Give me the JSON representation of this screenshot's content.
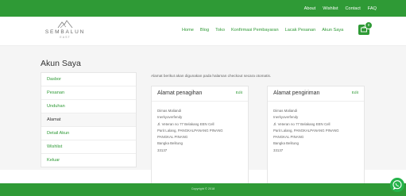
{
  "topbar": {
    "links": [
      "About",
      "Wishlist",
      "Contact",
      "FAQ"
    ]
  },
  "brand": {
    "name": "SEMBALUN",
    "tagline": "EAST"
  },
  "nav": {
    "items": [
      "Home",
      "Blog",
      "Toko",
      "Konfirmasi Pembayaran",
      "Lacak Pesanan",
      "Akun Saya"
    ]
  },
  "cart": {
    "count": "0"
  },
  "page": {
    "title": "Akun Saya",
    "note": "Alamat berikut akan digunakan pada halaman checkout secara otomatis."
  },
  "sidebar": {
    "items": [
      "Dasbor",
      "Pesanan",
      "Unduhan",
      "Alamat",
      "Detail Akun",
      "Wishlist",
      "Keluar"
    ],
    "active_index": 3
  },
  "billing": {
    "title": "Alamat penagihan",
    "edit_label": "Edit",
    "lines": [
      "Dimas Maliandi",
      "Inerkyoverfendy",
      "Jl. Veteran no 77 Belakang EEN Cell",
      "Parit Lalang, PANGKALPANANG PINANG",
      "PANGKAL PINANG",
      "Bangka Belitung",
      "33137"
    ]
  },
  "shipping": {
    "title": "Alamat pengiriman",
    "edit_label": "Edit",
    "lines": [
      "Dimas Maliandi",
      "Inerkyoverfendy",
      "Jl. Veteran no 77 Belakang EEN Cell",
      "Parit Lalang, PANGKALPANANG PINANG",
      "PANGKAL PINANG",
      "Bangka Belitung",
      "33137"
    ]
  },
  "footer": {
    "copyright": "Copyright © 2018"
  },
  "colors": {
    "brand": "#2f9a36",
    "whatsapp": "#25b34a"
  }
}
